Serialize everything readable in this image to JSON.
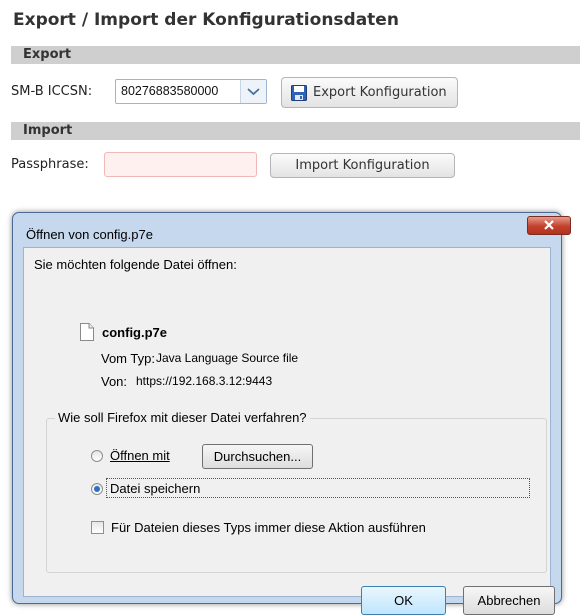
{
  "page": {
    "title": "Export / Import der Konfigurationsdaten"
  },
  "export_section": {
    "heading": "Export",
    "iccsn_label": "SM-B ICCSN:",
    "iccsn_value": "80276883580000",
    "export_button": "Export Konfiguration"
  },
  "import_section": {
    "heading": "Import",
    "passphrase_label": "Passphrase:",
    "passphrase_value": "",
    "import_button": "Import Konfiguration"
  },
  "dialog": {
    "title": "Öffnen von config.p7e",
    "intro": "Sie möchten folgende Datei öffnen:",
    "file_name": "config.p7e",
    "type_label": "Vom Typ:",
    "type_value": "Java Language Source file",
    "from_label": "Von:",
    "from_value": "https://192.168.3.12:9443",
    "question": "Wie soll Firefox mit dieser Datei verfahren?",
    "open_with_label": "Öffnen mit",
    "open_with_selected": false,
    "browse_button": "Durchsuchen...",
    "save_label": "Datei speichern",
    "save_selected": true,
    "always_label": "Für Dateien dieses Typs immer diese Aktion ausführen",
    "always_checked": false,
    "ok_button": "OK",
    "cancel_button": "Abbrechen"
  },
  "colors": {
    "section_bar": "#cfcfcf",
    "dialog_frame": "#c5d8ee",
    "dialog_body": "#f0f0f0",
    "close_button": "#c3412c",
    "passphrase_bg": "#fff0f0"
  }
}
